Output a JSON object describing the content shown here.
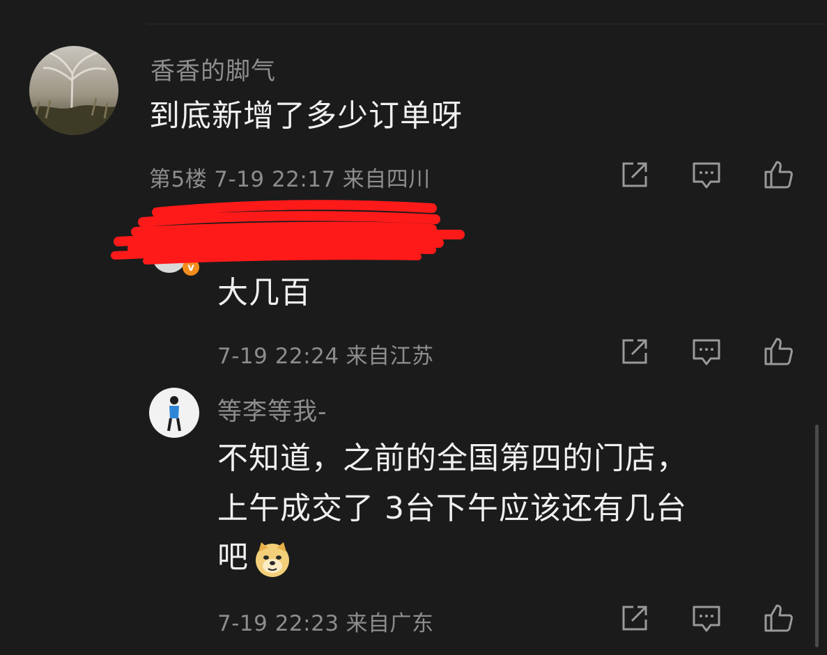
{
  "comments": [
    {
      "username": "香香的脚气",
      "content": "到底新增了多少订单呀",
      "floor": "第5楼",
      "time": "7-19 22:17",
      "location": "来自四川"
    },
    {
      "username": "",
      "badge": "v",
      "content": "大几百",
      "time": "7-19 22:24",
      "location": "来自江苏"
    },
    {
      "username": "等李等我-",
      "content_lines": [
        "不知道，之前的全国第四的门店，",
        "上午成交了 3台下午应该还有几台",
        "吧"
      ],
      "emoji": "doge-emoji",
      "time": "7-19 22:23",
      "location": "来自广东"
    }
  ],
  "icons": {
    "share": "share-icon",
    "reply": "comment-icon",
    "like": "thumbs-up-icon"
  },
  "colors": {
    "background": "#1b1b1b",
    "text": "#f0f0f0",
    "muted": "#8d8d8d",
    "redaction": "#ff1a1a",
    "badge": "#f28c1d"
  }
}
